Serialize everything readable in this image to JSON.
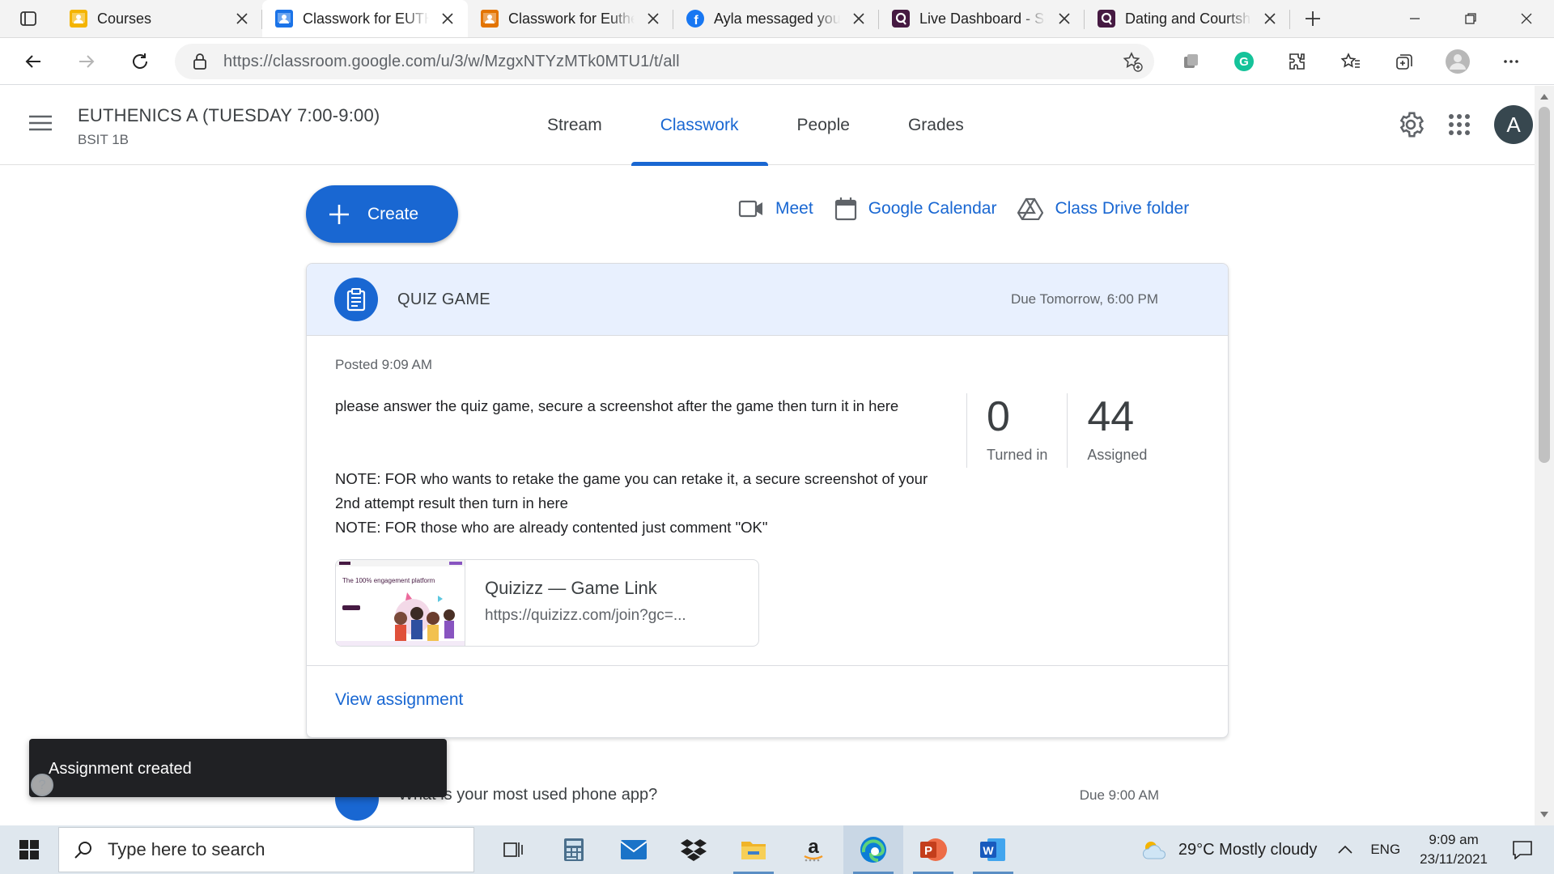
{
  "browser": {
    "tabs": [
      {
        "title": "Courses",
        "favicon": "classroom-icon",
        "color": "#f4b400",
        "active": false
      },
      {
        "title": "Classwork for EUTH",
        "favicon": "classroom-icon",
        "color": "#1a73e8",
        "active": true
      },
      {
        "title": "Classwork for Euthe",
        "favicon": "classroom-icon",
        "color": "#e37400",
        "active": false
      },
      {
        "title": "Ayla messaged you",
        "favicon": "facebook-icon",
        "color": "#1877f2",
        "active": false
      },
      {
        "title": "Live Dashboard - Su",
        "favicon": "quizizz-icon",
        "color": "#461a42",
        "active": false
      },
      {
        "title": "Dating and Courtsh",
        "favicon": "quizizz-icon",
        "color": "#461a42",
        "active": false
      }
    ],
    "url": "https://classroom.google.com/u/3/w/MzgxNTYzMTk0MTU1/t/all"
  },
  "classroom": {
    "class_name": "EUTHENICS A (TUESDAY 7:00-9:00)",
    "section": "BSIT 1B",
    "nav_tabs": [
      "Stream",
      "Classwork",
      "People",
      "Grades"
    ],
    "active_tab": "Classwork",
    "avatar_letter": "A",
    "create_label": "Create",
    "quick_links": {
      "meet": "Meet",
      "calendar": "Google Calendar",
      "drive": "Class Drive folder"
    }
  },
  "assignment": {
    "title": "QUIZ GAME",
    "due": "Due Tomorrow, 6:00 PM",
    "posted": "Posted 9:09 AM",
    "description": [
      "please answer the quiz game, secure a screenshot after the game then turn it in here",
      "NOTE: FOR who wants to retake the game you can retake it, a secure screenshot of your 2nd attempt result then turn in here",
      "NOTE: FOR those who are already contented just comment \"OK\""
    ],
    "stats": {
      "turned_in": "0",
      "turned_in_label": "Turned in",
      "assigned": "44",
      "assigned_label": "Assigned"
    },
    "attachment": {
      "title": "Quizizz — Game Link",
      "url": "https://quizizz.com/join?gc=...",
      "thumb_text": "The 100% engagement platform"
    },
    "view_label": "View assignment"
  },
  "next_item": {
    "title": "What is your most used phone app?",
    "due": "Due 9:00 AM"
  },
  "snackbar": {
    "message": "Assignment created",
    "help": "?"
  },
  "taskbar": {
    "search_placeholder": "Type here to search",
    "weather": "29°C  Mostly cloudy",
    "lang": "ENG",
    "time": "9:09 am",
    "date": "23/11/2021"
  },
  "colors": {
    "accent": "#1967d2",
    "card_header": "#e8f0fe",
    "snackbar": "#202124"
  }
}
